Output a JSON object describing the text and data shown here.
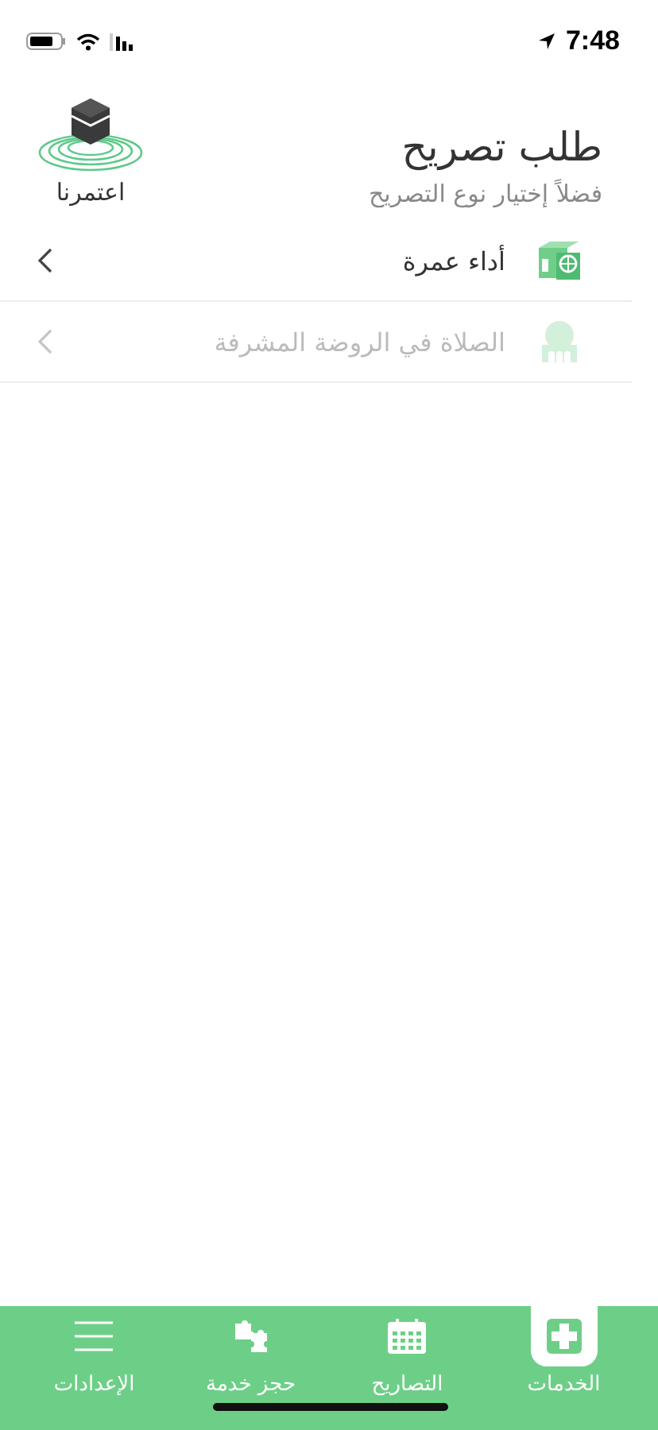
{
  "status_bar": {
    "time": "7:48"
  },
  "header": {
    "title": "طلب تصريح",
    "subtitle": "فضلاً إختيار نوع التصريح",
    "logo_text": "اعتمرنا"
  },
  "permits": [
    {
      "label": "أداء عمرة",
      "disabled": false
    },
    {
      "label": "الصلاة في الروضة المشرفة",
      "disabled": true
    }
  ],
  "tabs": [
    {
      "label": "الخدمات",
      "selected": true,
      "kind": "services"
    },
    {
      "label": "التصاريح",
      "selected": false,
      "kind": "calendar"
    },
    {
      "label": "حجز خدمة",
      "selected": false,
      "kind": "puzzle"
    },
    {
      "label": "الإعدادات",
      "selected": false,
      "kind": "menu"
    }
  ]
}
